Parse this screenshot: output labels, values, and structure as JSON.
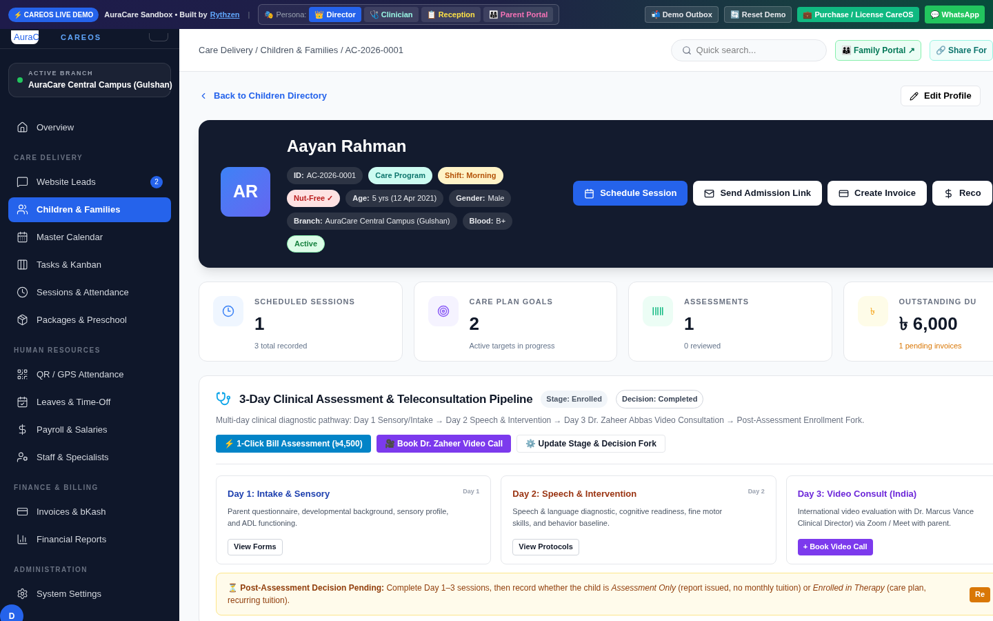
{
  "topbar": {
    "demo_badge": "⚡ CAREOS LIVE DEMO",
    "sandbox_text": "AuraCare Sandbox • Built by",
    "author_link": "Rythzen",
    "separator": "|",
    "persona_label": "🎭 Persona:",
    "personas": [
      {
        "label": "👑 Director",
        "selected": true,
        "kind": "director"
      },
      {
        "label": "🩺 Clinician",
        "selected": false,
        "kind": "clinician"
      },
      {
        "label": "📋 Reception",
        "selected": false,
        "kind": "reception"
      },
      {
        "label": "👨‍👩‍👧 Parent Portal",
        "selected": false,
        "kind": "parent"
      }
    ],
    "actions": [
      {
        "label": "📬 Demo Outbox",
        "kind": "ghost"
      },
      {
        "label": "🔄 Reset Demo",
        "kind": "ghost"
      },
      {
        "label": "💼 Purchase / License CareOS",
        "kind": "emerald"
      },
      {
        "label": "💬 WhatsApp",
        "kind": "green"
      }
    ]
  },
  "sidebar": {
    "logo_text": "AuraC",
    "brand": "CAREOS",
    "branch": {
      "label": "ACTIVE BRANCH",
      "name": "AuraCare Central Campus (Gulshan)"
    },
    "sections": [
      {
        "items": [
          {
            "label": "Overview",
            "selected": false
          }
        ]
      },
      {
        "title": "CARE DELIVERY",
        "items": [
          {
            "label": "Website Leads",
            "selected": false,
            "badge": "2"
          },
          {
            "label": "Children & Families",
            "selected": true
          },
          {
            "label": "Master Calendar",
            "selected": false
          },
          {
            "label": "Tasks & Kanban",
            "selected": false
          },
          {
            "label": "Sessions & Attendance",
            "selected": false
          },
          {
            "label": "Packages & Preschool",
            "selected": false
          }
        ]
      },
      {
        "title": "HUMAN RESOURCES",
        "items": [
          {
            "label": "QR / GPS Attendance",
            "selected": false
          },
          {
            "label": "Leaves & Time-Off",
            "selected": false
          },
          {
            "label": "Payroll & Salaries",
            "selected": false
          },
          {
            "label": "Staff & Specialists",
            "selected": false
          }
        ]
      },
      {
        "title": "FINANCE & BILLING",
        "items": [
          {
            "label": "Invoices & bKash",
            "selected": false
          },
          {
            "label": "Financial Reports",
            "selected": false
          }
        ]
      },
      {
        "title": "ADMINISTRATION",
        "items": [
          {
            "label": "System Settings",
            "selected": false
          }
        ]
      }
    ],
    "user_initial": "D"
  },
  "header": {
    "breadcrumb": "Care Delivery / Children & Families / AC-2026-0001",
    "search_placeholder": "Quick search...",
    "buttons": [
      {
        "label": "👨‍👩‍👦 Family Portal ↗",
        "kind": "green"
      },
      {
        "label": "🔗 Share For",
        "kind": "teal"
      }
    ]
  },
  "back_link": "Back to Children Directory",
  "edit_button": "Edit Profile",
  "profile": {
    "initials": "AR",
    "name": "Aayan Rahman",
    "chip_rows": [
      [
        {
          "label": "ID:",
          "value": "AC-2026-0001",
          "kind": "info"
        },
        {
          "value": "Care Program",
          "kind": "teal"
        },
        {
          "value": "Shift: Morning",
          "kind": "amber"
        }
      ],
      [
        {
          "value": "Nut-Free ✓",
          "kind": "red"
        },
        {
          "label": "Age:",
          "value": "5 yrs (12 Apr 2021)",
          "kind": "info"
        },
        {
          "label": "Gender:",
          "value": "Male",
          "kind": "info"
        }
      ],
      [
        {
          "label": "Branch:",
          "value": "AuraCare Central Campus (Gulshan)",
          "kind": "info"
        },
        {
          "label": "Blood:",
          "value": "B+",
          "kind": "info"
        }
      ],
      [
        {
          "value": "Active",
          "kind": "green"
        }
      ]
    ],
    "actions": [
      {
        "label": "Schedule Session",
        "kind": "primary"
      },
      {
        "label": "Send Admission Link",
        "kind": "light"
      },
      {
        "label": "Create Invoice",
        "kind": "light"
      },
      {
        "label": "Reco",
        "kind": "light"
      }
    ]
  },
  "stats": [
    {
      "title": "SCHEDULED SESSIONS",
      "value": "1",
      "sub": "3 total recorded",
      "kind": "blue"
    },
    {
      "title": "CARE PLAN GOALS",
      "value": "2",
      "sub": "Active targets in progress",
      "kind": "purple"
    },
    {
      "title": "ASSESSMENTS",
      "value": "1",
      "sub": "0 reviewed",
      "kind": "green"
    },
    {
      "title": "OUTSTANDING DU",
      "value": "৳ 6,000",
      "sub": "1 pending invoices",
      "kind": "amber",
      "symbol": "৳"
    }
  ],
  "pipeline": {
    "title": "3-Day Clinical Assessment & Teleconsultation Pipeline",
    "stage": "Stage: Enrolled",
    "decision": "Decision: Completed",
    "description": "Multi-day clinical diagnostic pathway: Day 1 Sensory/Intake → Day 2 Speech & Intervention → Day 3 Dr. Zaheer Abbas Video Consultation → Post-Assessment Enrollment Fork.",
    "buttons": [
      {
        "label": "⚡ 1-Click Bill Assessment (৳4,500)",
        "kind": "sky"
      },
      {
        "label": "🎥 Book Dr. Zaheer Video Call",
        "kind": "purple"
      },
      {
        "label": "⚙️ Update Stage & Decision Fork",
        "kind": "light"
      }
    ],
    "days": [
      {
        "title": "Day 1: Intake & Sensory",
        "tag": "Day 1",
        "lines": [
          "Parent questionnaire, developmental background, sensory profile,",
          "and ADL functioning."
        ],
        "button": "View Forms",
        "kind": "blue"
      },
      {
        "title": "Day 2: Speech & Intervention",
        "tag": "Day 2",
        "lines": [
          "Speech & language diagnostic, cognitive readiness, fine motor",
          "skills, and behavior baseline."
        ],
        "button": "View Protocols",
        "kind": "orange"
      },
      {
        "title": "Day 3: Video Consult (India)",
        "lines": [
          "International video evaluation with Dr. Marcus Vance",
          "Clinical Director) via Zoom / Meet with parent."
        ],
        "button": "+ Book Video Call",
        "kind": "purple"
      }
    ],
    "notice": {
      "text": "**⏳ Post-Assessment Decision Pending:** Complete Day 1–3 sessions, then record whether the child is *Assessment Only* (report issued, no monthly tuition) or *Enrolled in Therapy* (care plan, recurring tuition).",
      "button": "Re"
    }
  }
}
